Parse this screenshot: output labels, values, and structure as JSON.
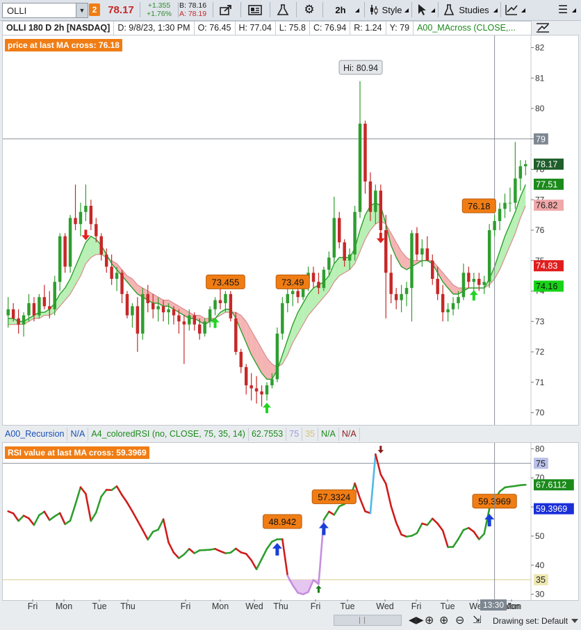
{
  "toolbar": {
    "symbol": "OLLI",
    "link_number": "2",
    "last_price": "78.17",
    "net_change": "+1.355",
    "pct_change": "+1.76%",
    "bid": "B: 78.16",
    "ask": "A: 78.19",
    "interval": "2h",
    "style_label": "Style",
    "studies_label": "Studies"
  },
  "infobar": {
    "title": "OLLI 180 D 2h [NASDAQ]",
    "date": "D: 9/8/23, 1:30 PM",
    "open": "O: 76.45",
    "high": "H: 77.04",
    "low": "L: 75.8",
    "close": "C: 76.94",
    "range": "R: 1.24",
    "y": "Y: 79",
    "study": "A00_MAcross (CLOSE,..."
  },
  "price_panel": {
    "label": "price at last MA cross: 76.18",
    "y_ticks": [
      "82",
      "81",
      "80",
      "79",
      "78",
      "77",
      "76",
      "75",
      "74",
      "73",
      "72",
      "71",
      "70"
    ],
    "badges": {
      "crosshair": "79",
      "last": "78.17",
      "ma_fast": "77.51",
      "ma_slow": "76.82",
      "red": "74.83",
      "green": "74.16"
    },
    "bubbles": [
      "73.455",
      "73.49",
      "76.18"
    ],
    "hi_label": "Hi: 80.94",
    "colors": {
      "up": "#2e9e2e",
      "down": "#c62828",
      "fill_up": "#b9f0b5",
      "fill_down": "#f5b4b4",
      "label": "#f07d14"
    }
  },
  "study_bar": {
    "recursion": "A00_Recursion",
    "na1": "N/A",
    "rsi_params": "A4_coloredRSI (no, CLOSE, 75, 35, 14)",
    "rsi_val": "62.7553",
    "ob": "75",
    "os": "35",
    "na2": "N/A",
    "na3": "N/A"
  },
  "rsi_panel": {
    "label": "RSI value at last MA cross: 59.3969",
    "y_ticks": [
      "80",
      "70",
      "60",
      "50",
      "40",
      "30"
    ],
    "badges": {
      "ob": "75",
      "rsi": "67.6112",
      "cross": "59.3969",
      "os": "35"
    },
    "bubbles": [
      "48.942",
      "57.3324",
      "59.3969"
    ]
  },
  "x_axis": {
    "labels": [
      "Fri",
      "Mon",
      "Tue",
      "Thu",
      "Fri",
      "Mon",
      "Wed",
      "Thu",
      "Fri",
      "Tue",
      "Wed",
      "Fri",
      "Tue",
      "Wed",
      "Fri",
      "Mon"
    ],
    "cursor_time": "13:30"
  },
  "statusbar": {
    "drawing_set": "Drawing set: Default"
  },
  "chart_data": {
    "type": "candlestick",
    "ylim": [
      69.6,
      82.4
    ],
    "ohlc": [
      [
        73.2,
        73.8,
        72.8,
        73.4
      ],
      [
        73.4,
        73.6,
        73.0,
        73.1
      ],
      [
        73.1,
        73.4,
        72.6,
        72.9
      ],
      [
        72.9,
        73.3,
        72.5,
        73.2
      ],
      [
        73.2,
        73.9,
        73.0,
        73.6
      ],
      [
        73.6,
        73.8,
        73.0,
        73.2
      ],
      [
        73.2,
        73.9,
        73.1,
        73.8
      ],
      [
        73.8,
        74.2,
        73.4,
        73.5
      ],
      [
        73.5,
        74.0,
        73.1,
        73.4
      ],
      [
        73.4,
        74.5,
        73.2,
        74.3
      ],
      [
        74.3,
        75.9,
        74.0,
        75.8
      ],
      [
        75.8,
        75.9,
        74.6,
        74.8
      ],
      [
        74.8,
        76.5,
        74.6,
        76.4
      ],
      [
        76.4,
        77.5,
        76.0,
        76.2
      ],
      [
        76.2,
        76.9,
        75.8,
        76.6
      ],
      [
        76.6,
        77.5,
        76.3,
        76.8
      ],
      [
        76.8,
        77.0,
        76.0,
        76.2
      ],
      [
        76.2,
        76.4,
        75.6,
        75.8
      ],
      [
        75.8,
        75.9,
        75.0,
        75.2
      ],
      [
        75.2,
        75.4,
        74.6,
        74.8
      ],
      [
        74.8,
        75.2,
        74.2,
        74.4
      ],
      [
        74.4,
        74.8,
        74.0,
        74.6
      ],
      [
        74.6,
        74.7,
        73.6,
        73.9
      ],
      [
        73.9,
        74.0,
        73.1,
        73.2
      ],
      [
        73.2,
        73.6,
        72.8,
        73.5
      ],
      [
        73.5,
        73.8,
        72.0,
        72.6
      ],
      [
        72.6,
        74.1,
        72.4,
        73.9
      ],
      [
        73.9,
        74.2,
        73.3,
        73.6
      ],
      [
        73.6,
        73.9,
        73.1,
        73.4
      ],
      [
        73.4,
        73.8,
        73.0,
        73.5
      ],
      [
        73.5,
        73.7,
        73.0,
        73.3
      ],
      [
        73.3,
        73.6,
        72.9,
        73.4
      ],
      [
        73.4,
        73.5,
        72.9,
        73.2
      ],
      [
        73.2,
        73.4,
        72.6,
        73.0
      ],
      [
        73.0,
        73.2,
        71.6,
        72.9
      ],
      [
        72.9,
        73.4,
        72.7,
        73.2
      ],
      [
        73.2,
        73.3,
        72.7,
        72.9
      ],
      [
        72.9,
        73.1,
        72.4,
        72.6
      ],
      [
        72.6,
        73.1,
        72.5,
        73.0
      ],
      [
        73.0,
        73.5,
        72.8,
        73.4
      ],
      [
        73.4,
        73.8,
        73.2,
        73.7
      ],
      [
        73.7,
        74.1,
        73.4,
        73.6
      ],
      [
        73.6,
        74.0,
        73.3,
        73.9
      ],
      [
        73.9,
        74.0,
        73.0,
        73.1
      ],
      [
        73.1,
        73.3,
        71.9,
        72.0
      ],
      [
        72.0,
        72.1,
        71.3,
        71.5
      ],
      [
        71.5,
        71.6,
        70.6,
        70.9
      ],
      [
        70.9,
        71.3,
        70.4,
        70.8
      ],
      [
        70.8,
        71.2,
        70.3,
        70.7
      ],
      [
        70.7,
        70.9,
        70.2,
        70.6
      ],
      [
        70.6,
        71.0,
        70.4,
        70.9
      ],
      [
        70.9,
        71.3,
        70.8,
        71.1
      ],
      [
        71.1,
        72.8,
        71.0,
        72.6
      ],
      [
        72.6,
        73.8,
        72.4,
        73.6
      ],
      [
        73.6,
        74.1,
        73.3,
        73.9
      ],
      [
        73.9,
        74.2,
        73.5,
        74.0
      ],
      [
        74.0,
        74.3,
        73.6,
        73.8
      ],
      [
        73.8,
        74.5,
        73.7,
        74.4
      ],
      [
        74.4,
        74.8,
        74.0,
        74.6
      ],
      [
        74.6,
        74.8,
        74.1,
        74.3
      ],
      [
        74.3,
        74.6,
        73.9,
        74.1
      ],
      [
        74.1,
        74.8,
        74.0,
        74.7
      ],
      [
        74.7,
        75.3,
        74.5,
        75.1
      ],
      [
        75.1,
        77.1,
        74.9,
        76.4
      ],
      [
        76.4,
        76.6,
        75.4,
        75.6
      ],
      [
        75.6,
        75.7,
        74.8,
        75.0
      ],
      [
        75.0,
        75.4,
        74.7,
        75.2
      ],
      [
        75.2,
        76.8,
        75.0,
        76.6
      ],
      [
        76.6,
        80.9,
        76.4,
        79.5
      ],
      [
        79.5,
        79.6,
        77.2,
        77.6
      ],
      [
        77.6,
        77.9,
        76.3,
        76.6
      ],
      [
        76.6,
        77.5,
        76.2,
        77.3
      ],
      [
        77.3,
        77.5,
        75.8,
        76.0
      ],
      [
        76.0,
        76.5,
        73.1,
        74.6
      ],
      [
        74.6,
        75.2,
        73.6,
        73.9
      ],
      [
        73.9,
        74.1,
        73.4,
        73.7
      ],
      [
        73.7,
        74.2,
        73.3,
        73.9
      ],
      [
        73.9,
        74.3,
        73.5,
        74.1
      ],
      [
        74.1,
        76.0,
        73.0,
        75.9
      ],
      [
        75.9,
        76.1,
        75.0,
        75.2
      ],
      [
        75.2,
        75.7,
        74.8,
        75.4
      ],
      [
        75.4,
        75.8,
        75.0,
        75.0
      ],
      [
        75.0,
        75.2,
        74.2,
        74.4
      ],
      [
        74.4,
        74.8,
        73.7,
        73.9
      ],
      [
        73.9,
        74.2,
        73.0,
        73.3
      ],
      [
        73.3,
        73.6,
        73.0,
        73.4
      ],
      [
        73.4,
        73.8,
        73.2,
        73.6
      ],
      [
        73.6,
        74.0,
        73.4,
        73.8
      ],
      [
        73.8,
        74.9,
        73.7,
        74.6
      ],
      [
        74.6,
        74.8,
        74.1,
        74.3
      ],
      [
        74.3,
        74.6,
        73.9,
        74.4
      ],
      [
        74.4,
        74.6,
        74.0,
        74.2
      ],
      [
        74.2,
        74.5,
        73.9,
        74.3
      ],
      [
        74.3,
        76.2,
        74.1,
        76.0
      ],
      [
        76.0,
        76.5,
        75.8,
        76.3
      ],
      [
        76.3,
        76.9,
        76.0,
        76.7
      ],
      [
        76.7,
        77.2,
        76.4,
        76.9
      ],
      [
        76.9,
        77.4,
        76.6,
        76.9
      ],
      [
        76.9,
        78.9,
        76.7,
        77.7
      ],
      [
        77.7,
        78.3,
        77.3,
        78.1
      ],
      [
        78.1,
        78.3,
        77.8,
        78.17
      ]
    ],
    "ma_fast": [
      73.1,
      73.1,
      73.0,
      73.0,
      73.1,
      73.2,
      73.3,
      73.3,
      73.4,
      73.6,
      73.9,
      74.1,
      74.4,
      74.8,
      75.2,
      75.6,
      75.8,
      75.7,
      75.5,
      75.2,
      74.9,
      74.7,
      74.5,
      74.3,
      74.1,
      73.9,
      73.8,
      73.7,
      73.6,
      73.6,
      73.5,
      73.5,
      73.4,
      73.3,
      73.2,
      73.1,
      73.1,
      73.0,
      72.9,
      73.0,
      73.1,
      73.3,
      73.4,
      73.4,
      73.1,
      72.7,
      72.3,
      71.9,
      71.6,
      71.3,
      71.1,
      71.1,
      71.4,
      71.9,
      72.4,
      72.9,
      73.3,
      73.6,
      73.9,
      74.1,
      74.2,
      74.3,
      74.5,
      74.9,
      75.1,
      75.1,
      75.1,
      75.4,
      76.0,
      76.5,
      76.8,
      76.9,
      76.8,
      76.2,
      75.5,
      75.1,
      74.8,
      74.7,
      74.8,
      74.9,
      75.0,
      75.0,
      74.9,
      74.6,
      74.3,
      74.1,
      73.9,
      73.9,
      74.0,
      74.1,
      74.1,
      74.1,
      74.1,
      74.4,
      74.8,
      75.3,
      75.8,
      76.2,
      76.6,
      77.1,
      77.5
    ],
    "ma_slow": [
      72.9,
      72.9,
      72.9,
      72.9,
      73.0,
      73.1,
      73.1,
      73.2,
      73.2,
      73.3,
      73.5,
      73.7,
      73.9,
      74.2,
      74.5,
      74.9,
      75.1,
      75.2,
      75.2,
      75.1,
      75.0,
      74.9,
      74.7,
      74.5,
      74.4,
      74.2,
      74.1,
      74.0,
      73.9,
      73.8,
      73.7,
      73.7,
      73.6,
      73.5,
      73.4,
      73.3,
      73.2,
      73.2,
      73.1,
      73.1,
      73.1,
      73.2,
      73.3,
      73.3,
      73.3,
      73.2,
      73.0,
      72.7,
      72.4,
      72.1,
      71.8,
      71.6,
      71.5,
      71.6,
      71.9,
      72.3,
      72.6,
      72.9,
      73.2,
      73.4,
      73.6,
      73.8,
      74.0,
      74.3,
      74.5,
      74.6,
      74.7,
      74.9,
      75.3,
      75.7,
      76.0,
      76.2,
      76.3,
      76.2,
      75.9,
      75.6,
      75.3,
      75.1,
      75.0,
      75.0,
      75.0,
      75.0,
      75.0,
      74.8,
      74.6,
      74.4,
      74.2,
      74.1,
      74.1,
      74.1,
      74.1,
      74.1,
      74.1,
      74.2,
      74.4,
      74.7,
      75.1,
      75.5,
      75.9,
      76.4,
      76.8
    ],
    "rsi": [
      58.5,
      57.8,
      55.2,
      57.0,
      56.1,
      53.8,
      57.2,
      58.4,
      55.5,
      56.8,
      57.9,
      54.1,
      55.3,
      60.9,
      66.8,
      64.5,
      55.2,
      58.1,
      63.6,
      65.9,
      65.8,
      67.1,
      64.1,
      61.5,
      58.5,
      55.3,
      52.1,
      48.8,
      51.5,
      52.2,
      55.8,
      47.8,
      44.3,
      42.4,
      43.7,
      45.6,
      44.1,
      45.1,
      45.2,
      45.3,
      45.6,
      44.8,
      44.1,
      44.3,
      45.7,
      44.4,
      43.9,
      41.7,
      38.6,
      42.1,
      45.6,
      48.1,
      48.9,
      48.9,
      36.4,
      33.1,
      30.5,
      30.0,
      30.8,
      34.9,
      33.5,
      55.6,
      58.4,
      57.3,
      60.2,
      61.0,
      62.4,
      68.1,
      62.9,
      58.5,
      57.9,
      78.1,
      71.2,
      68.0,
      60.3,
      54.6,
      50.5,
      49.8,
      50.1,
      51.0,
      54.3,
      53.8,
      56.0,
      54.3,
      51.9,
      46.2,
      46.3,
      49.0,
      52.1,
      52.8,
      51.5,
      48.9,
      50.8,
      59.4,
      62.5,
      65.3,
      66.7,
      67.0,
      67.2,
      67.5,
      67.61
    ],
    "rsi_ylim": [
      28,
      82
    ],
    "rsi_ob": 75,
    "rsi_os": 35
  }
}
